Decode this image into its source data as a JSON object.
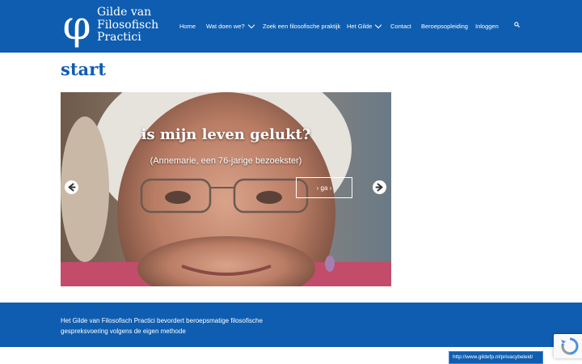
{
  "brand": {
    "name_lines": [
      "Gilde van",
      "Filosofisch",
      "Practici"
    ],
    "logo_symbol": "φ"
  },
  "nav": {
    "items": [
      {
        "label": "Home"
      },
      {
        "label": "Wat doen we?",
        "icon": "chevron-down-icon"
      },
      {
        "label": "Zoek een filosofische praktijk"
      },
      {
        "label": "Het Gilde",
        "icon": "chevron-down-icon"
      },
      {
        "label": "Contact"
      },
      {
        "label": "Beroepsopleiding"
      },
      {
        "label": "Inloggen"
      }
    ],
    "search_icon": "search-icon"
  },
  "page": {
    "title": "start"
  },
  "slider": {
    "headline": "is mijn leven gelukt?",
    "subtitle": "(Annemarie, een 76-jarige bezoekster)",
    "button_label": "› ga ›",
    "prev_icon": "arrow-left-circle-icon",
    "next_icon": "arrow-right-circle-icon"
  },
  "footer": {
    "text_lines": [
      "Het Gilde van Filosofisch Practici bevordert beroepsmatige filosofische",
      "gespreksvoering volgens de eigen methode"
    ]
  },
  "privacy_link": "http://www.gildefp.nl/privacybeleid/",
  "colors": {
    "brand_blue": "#0e5db0",
    "white": "#ffffff"
  }
}
